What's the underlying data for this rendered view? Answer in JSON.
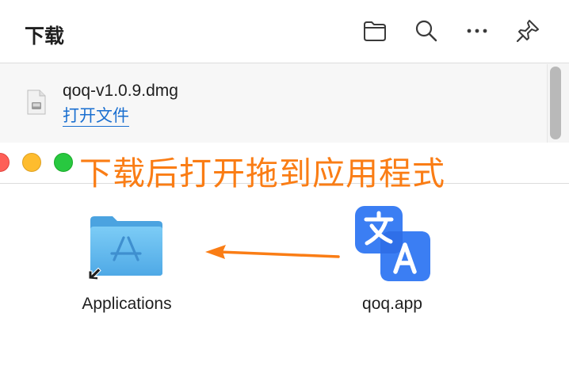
{
  "downloads": {
    "title": "下载",
    "toolbar_icons": [
      "folder-icon",
      "search-icon",
      "more-icon",
      "pin-icon"
    ],
    "item": {
      "file_name": "qoq-v1.0.9.dmg",
      "open_label": "打开文件",
      "icon": "disk-image-icon"
    }
  },
  "dmg_window": {
    "instruction": "下载后打开拖到应用程式",
    "traffic_lights": [
      "close",
      "minimize",
      "zoom"
    ],
    "items": [
      {
        "label": "Applications",
        "icon": "applications-folder-icon"
      },
      {
        "label": "qoq.app",
        "icon": "translate-app-icon"
      }
    ]
  },
  "colors": {
    "accent_orange": "#fa7d15",
    "link_blue": "#1a6fd0",
    "app_blue": "#3478f6",
    "folder_blue": "#5db8ee"
  }
}
